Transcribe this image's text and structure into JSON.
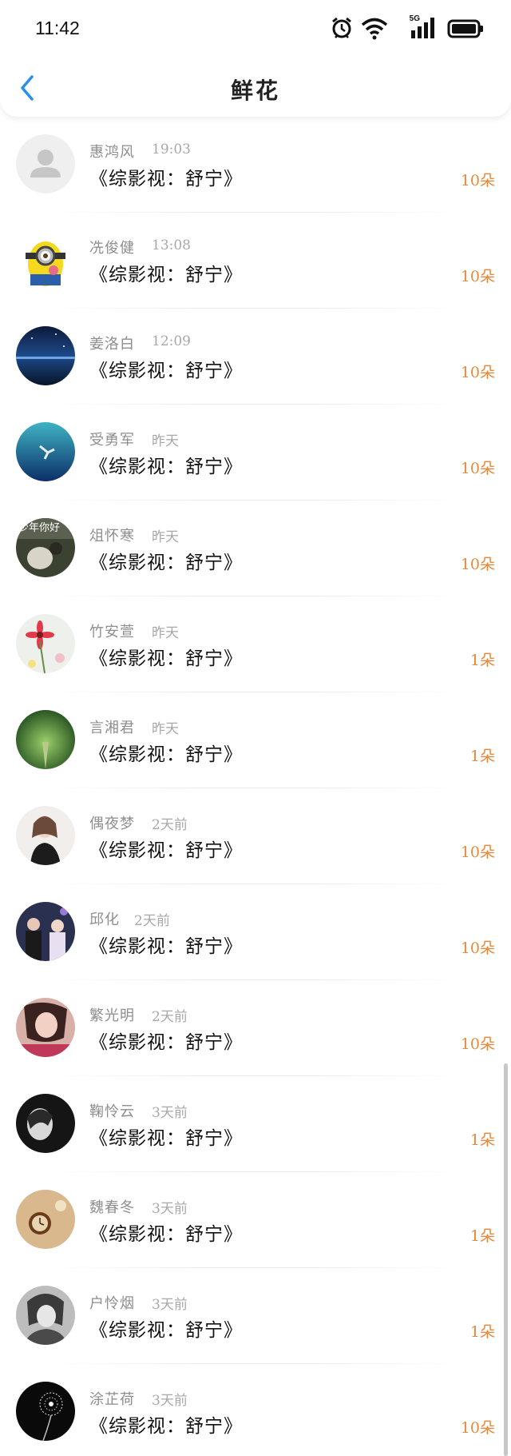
{
  "status": {
    "time": "11:42",
    "network": "5G"
  },
  "header": {
    "title": "鲜花"
  },
  "items": [
    {
      "name": "惠鸿风",
      "time": "19:03",
      "book": "《综影视：舒宁》",
      "count": "10朵",
      "avatar": "default-avatar"
    },
    {
      "name": "冼俊健",
      "time": "13:08",
      "book": "《综影视：舒宁》",
      "count": "10朵",
      "avatar": "minion-avatar"
    },
    {
      "name": "姜洛白",
      "time": "12:09",
      "book": "《综影视：舒宁》",
      "count": "10朵",
      "avatar": "night-lake-avatar"
    },
    {
      "name": "受勇军",
      "time": "昨天",
      "book": "《综影视：舒宁》",
      "count": "10朵",
      "avatar": "underwater-avatar"
    },
    {
      "name": "俎怀寒",
      "time": "昨天",
      "book": "《综影视：舒宁》",
      "count": "10朵",
      "avatar": "photo-avatar",
      "avatar_text": "少年你好"
    },
    {
      "name": "竹安萱",
      "time": "昨天",
      "book": "《综影视：舒宁》",
      "count": "1朵",
      "avatar": "flower-avatar"
    },
    {
      "name": "言湘君",
      "time": "昨天",
      "book": "《综影视：舒宁》",
      "count": "1朵",
      "avatar": "forest-avatar"
    },
    {
      "name": "偶夜梦",
      "time": "2天前",
      "book": "《综影视：舒宁》",
      "count": "10朵",
      "avatar": "girl-avatar"
    },
    {
      "name": "邱化",
      "time": "2天前",
      "book": "《综影视：舒宁》",
      "count": "10朵",
      "avatar": "group-avatar"
    },
    {
      "name": "繁光明",
      "time": "2天前",
      "book": "《综影视：舒宁》",
      "count": "10朵",
      "avatar": "portrait-avatar"
    },
    {
      "name": "鞠怜云",
      "time": "3天前",
      "book": "《综影视：舒宁》",
      "count": "1朵",
      "avatar": "bw-portrait-avatar"
    },
    {
      "name": "魏春冬",
      "time": "3天前",
      "book": "《综影视：舒宁》",
      "count": "1朵",
      "avatar": "watch-avatar"
    },
    {
      "name": "户怜烟",
      "time": "3天前",
      "book": "《综影视：舒宁》",
      "count": "1朵",
      "avatar": "gray-portrait-avatar"
    },
    {
      "name": "涂芷荷",
      "time": "3天前",
      "book": "《综影视：舒宁》",
      "count": "10朵",
      "avatar": "dandelion-avatar"
    }
  ],
  "colors": {
    "accent": "#2a8fe6",
    "count": "#e8883a"
  }
}
